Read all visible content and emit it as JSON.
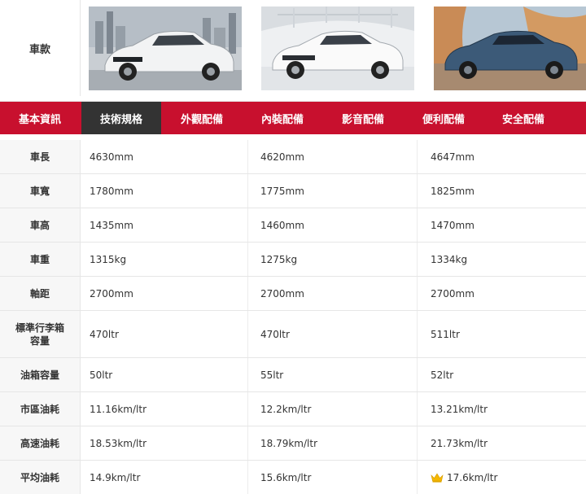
{
  "header": {
    "label": "車款",
    "cars": [
      {
        "name": "car-1",
        "color": "#e9ecef"
      },
      {
        "name": "car-2",
        "color": "#ffffff"
      },
      {
        "name": "car-3",
        "color": "#3c5a78"
      }
    ]
  },
  "tabs": [
    {
      "label": "基本資訊",
      "active": false
    },
    {
      "label": "技術規格",
      "active": true
    },
    {
      "label": "外觀配備",
      "active": false
    },
    {
      "label": "內裝配備",
      "active": false
    },
    {
      "label": "影音配備",
      "active": false
    },
    {
      "label": "便利配備",
      "active": false
    },
    {
      "label": "安全配備",
      "active": false
    }
  ],
  "colors": {
    "tab_bar": "#c8102e",
    "tab_active": "#333333",
    "crown": "#f5b800"
  },
  "rows": [
    {
      "label": "車長",
      "values": [
        "4630mm",
        "4620mm",
        "4647mm"
      ]
    },
    {
      "label": "車寬",
      "values": [
        "1780mm",
        "1775mm",
        "1825mm"
      ]
    },
    {
      "label": "車高",
      "values": [
        "1435mm",
        "1460mm",
        "1470mm"
      ]
    },
    {
      "label": "車重",
      "values": [
        "1315kg",
        "1275kg",
        "1334kg"
      ]
    },
    {
      "label": "軸距",
      "values": [
        "2700mm",
        "2700mm",
        "2700mm"
      ]
    },
    {
      "label": "標準行李箱容量",
      "label_line1": "標準行李箱",
      "label_line2": "容量",
      "values": [
        "470ltr",
        "470ltr",
        "511ltr"
      ]
    },
    {
      "label": "油箱容量",
      "values": [
        "50ltr",
        "55ltr",
        "52ltr"
      ]
    },
    {
      "label": "市區油耗",
      "values": [
        "11.16km/ltr",
        "12.2km/ltr",
        "13.21km/ltr"
      ]
    },
    {
      "label": "高速油耗",
      "values": [
        "18.53km/ltr",
        "18.79km/ltr",
        "21.73km/ltr"
      ]
    },
    {
      "label": "平均油耗",
      "values": [
        "14.9km/ltr",
        "15.6km/ltr",
        "17.6km/ltr"
      ],
      "winner_icon": "crown-icon"
    }
  ]
}
